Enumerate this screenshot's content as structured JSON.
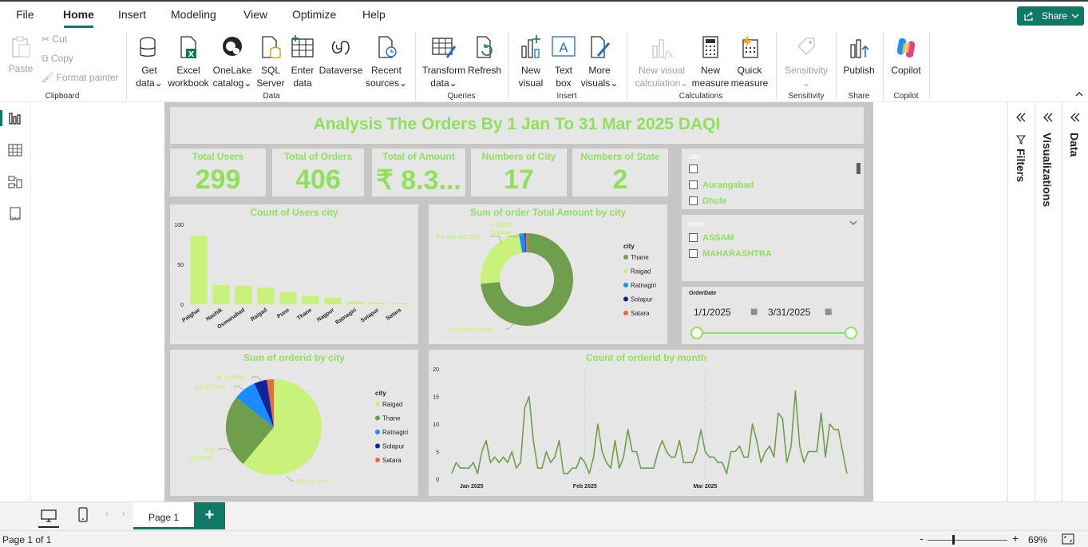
{
  "menu": {
    "file": "File",
    "home": "Home",
    "insert": "Insert",
    "modeling": "Modeling",
    "view": "View",
    "optimize": "Optimize",
    "help": "Help",
    "share": "Share"
  },
  "ribbon": {
    "paste": "Paste",
    "cut": "Cut",
    "copy": "Copy",
    "format_painter": "Format painter",
    "get_data": [
      "Get",
      "data"
    ],
    "excel": [
      "Excel",
      "workbook"
    ],
    "onelake": [
      "OneLake",
      "catalog"
    ],
    "sql": [
      "SQL",
      "Server"
    ],
    "enter_data": [
      "Enter",
      "data"
    ],
    "dataverse": "Dataverse",
    "recent": [
      "Recent",
      "sources"
    ],
    "transform": [
      "Transform",
      "data"
    ],
    "refresh": "Refresh",
    "new_visual": [
      "New",
      "visual"
    ],
    "text_box": [
      "Text",
      "box"
    ],
    "more_visuals": [
      "More",
      "visuals"
    ],
    "new_visual_calc": [
      "New visual",
      "calculation"
    ],
    "new_measure": [
      "New",
      "measure"
    ],
    "quick_measure": [
      "Quick",
      "measure"
    ],
    "sensitivity": "Sensitivity",
    "publish": "Publish",
    "copilot": "Copilot",
    "groups": {
      "clipboard": "Clipboard",
      "data": "Data",
      "queries": "Queries",
      "insert": "Insert",
      "calculations": "Calculations",
      "sensitivity": "Sensitivity",
      "share": "Share",
      "copilot": "Copilot"
    }
  },
  "report": {
    "title": "Analysis The Orders By 1 Jan To 31 Mar 2025 DAQI",
    "kpis": [
      {
        "label": "Total Users",
        "value": "299"
      },
      {
        "label": "Total of Orders",
        "value": "406"
      },
      {
        "label": "Total of Amount",
        "value": "₹ 8.3..."
      },
      {
        "label": "Numbers of City",
        "value": "17"
      },
      {
        "label": "Numbers of State",
        "value": "2"
      }
    ],
    "city_slicer": {
      "header": "city",
      "items": [
        "Aurangabad",
        "Dhule"
      ]
    },
    "state_slicer": {
      "header": "state",
      "items": [
        "ASSAM",
        "MAHARASHTRA"
      ]
    },
    "date_slicer": {
      "header": "OrderDate",
      "start": "1/1/2025",
      "end": "3/31/2025"
    },
    "colors": {
      "accent": "#8fe05a",
      "thane": "#6f9e4c",
      "raigad": "#c8f27a",
      "ratnagiri": "#1a8cff",
      "solapur": "#12239e",
      "satara": "#e66c37"
    }
  },
  "chart_data": [
    {
      "type": "bar",
      "title": "Count of Users city",
      "categories": [
        "Palghar",
        "Nashik",
        "Osmanabad",
        "Raigad",
        "Pune",
        "Thane",
        "Nagpur",
        "Ratnagiri",
        "Solapur",
        "Satara"
      ],
      "values": [
        86,
        24,
        23,
        21,
        15,
        11,
        8,
        3,
        2,
        1
      ],
      "ylim": [
        0,
        100
      ],
      "yticks": [
        "0",
        "50",
        "100"
      ]
    },
    {
      "type": "pie",
      "title": "Sum of order Total Amount by city",
      "legend_title": "city",
      "labels": [
        "Thane",
        "Raigad",
        "Ratnagiri",
        "Solapur",
        "Satara"
      ],
      "values": [
        73.25,
        23.72,
        2.0,
        0.34,
        0.69
      ],
      "data_labels": [
        "₹ 1.91M (73.25%)",
        "₹ 0.62M (23.72%)",
        "₹ 0.02M",
        "(0.69%)"
      ]
    },
    {
      "type": "pie",
      "title": "Sum of orderid by city",
      "legend_title": "city",
      "labels": [
        "Raigad",
        "Thane",
        "Ratnagiri",
        "Solapur",
        "Satara"
      ],
      "values": [
        61.11,
        24.59,
        7.65,
        4.32,
        2.33
      ],
      "data_labels": [
        "81K (61.11%)",
        "33K",
        "(24.59%)",
        "10K (7.65%)",
        "6K (4.32%)"
      ]
    },
    {
      "type": "line",
      "title": "Count of orderid by month",
      "x": [
        "2025-01-01",
        "2025-01-02",
        "2025-01-03",
        "2025-01-04",
        "2025-01-05",
        "2025-01-06",
        "2025-01-07",
        "2025-01-08",
        "2025-01-09",
        "2025-01-10",
        "2025-01-11",
        "2025-01-12",
        "2025-01-13",
        "2025-01-14",
        "2025-01-15",
        "2025-01-16",
        "2025-01-17",
        "2025-01-18",
        "2025-01-19",
        "2025-01-20",
        "2025-01-21",
        "2025-01-22",
        "2025-01-23",
        "2025-01-24",
        "2025-01-25",
        "2025-01-26",
        "2025-01-27",
        "2025-01-28",
        "2025-01-29",
        "2025-01-30",
        "2025-01-31",
        "2025-02-01",
        "2025-02-02",
        "2025-02-03",
        "2025-02-04",
        "2025-02-05",
        "2025-02-06",
        "2025-02-07",
        "2025-02-08",
        "2025-02-09",
        "2025-02-10",
        "2025-02-11",
        "2025-02-12",
        "2025-02-13",
        "2025-02-14",
        "2025-02-15",
        "2025-02-16",
        "2025-02-17",
        "2025-02-18",
        "2025-02-19",
        "2025-02-20",
        "2025-02-21",
        "2025-02-22",
        "2025-02-23",
        "2025-02-24",
        "2025-02-25",
        "2025-02-26",
        "2025-02-27",
        "2025-02-28",
        "2025-03-01",
        "2025-03-02",
        "2025-03-03",
        "2025-03-04",
        "2025-03-05",
        "2025-03-06",
        "2025-03-07",
        "2025-03-08",
        "2025-03-09",
        "2025-03-10",
        "2025-03-11",
        "2025-03-12",
        "2025-03-13",
        "2025-03-14",
        "2025-03-15",
        "2025-03-16",
        "2025-03-17",
        "2025-03-18",
        "2025-03-19",
        "2025-03-20",
        "2025-03-21",
        "2025-03-22",
        "2025-03-23",
        "2025-03-24",
        "2025-03-25",
        "2025-03-26",
        "2025-03-27",
        "2025-03-28",
        "2025-03-29",
        "2025-03-30",
        "2025-03-31"
      ],
      "values": [
        1,
        3,
        2,
        2,
        2,
        3,
        1,
        5,
        7,
        3,
        4,
        3,
        4,
        3,
        5,
        2,
        3,
        13,
        15,
        7,
        2,
        2,
        5,
        3,
        4,
        7,
        1,
        1,
        2,
        2,
        4,
        3,
        1,
        4,
        10,
        5,
        3,
        2,
        7,
        2,
        4,
        9,
        5,
        5,
        2,
        2,
        2,
        2,
        5,
        7,
        5,
        4,
        4,
        7,
        3,
        3,
        3,
        5,
        9,
        5,
        4,
        4,
        3,
        3,
        1,
        5,
        5,
        6,
        4,
        4,
        10,
        7,
        3,
        5,
        6,
        4,
        12,
        11,
        3,
        6,
        16,
        6,
        3,
        5,
        5,
        5,
        12,
        4,
        10,
        9,
        9,
        5,
        1
      ],
      "ylim": [
        0,
        20
      ],
      "yticks": [
        "0",
        "5",
        "10",
        "15",
        "20"
      ],
      "xtick_labels": [
        "Jan 2025",
        "Feb 2025",
        "Mar 2025"
      ]
    }
  ],
  "right_panes": {
    "filters": "Filters",
    "visualizations": "Visualizations",
    "data": "Data"
  },
  "pages": {
    "tab": "Page 1",
    "add": "+"
  },
  "status": {
    "page": "Page 1 of 1",
    "zoom": "69%",
    "minus": "-",
    "plus": "+"
  }
}
